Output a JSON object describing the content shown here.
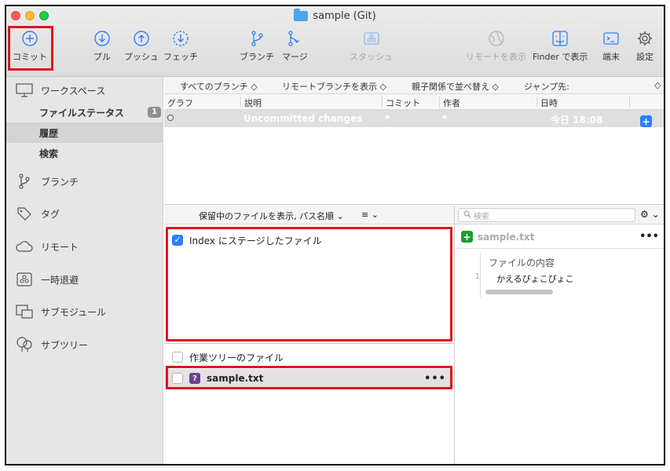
{
  "window": {
    "title": "sample (Git)"
  },
  "toolbar": {
    "commit": "コミット",
    "pull": "プル",
    "push": "プッシュ",
    "fetch": "フェッチ",
    "branch": "ブランチ",
    "merge": "マージ",
    "stash": "スタッシュ",
    "show_remote": "リモートを表示",
    "show_in_finder": "Finder で表示",
    "terminal": "端末",
    "settings": "設定"
  },
  "sidebar": {
    "workspace": "ワークスペース",
    "file_status": "ファイルステータス",
    "file_status_count": "1",
    "history": "履歴",
    "search": "検索",
    "branches": "ブランチ",
    "tags": "タグ",
    "remotes": "リモート",
    "stashes": "一時退避",
    "submodules": "サブモジュール",
    "subtrees": "サブツリー"
  },
  "history_filter": {
    "all_branches": "すべてのブランチ",
    "show_remote_branches": "リモートブランチを表示",
    "sort": "親子関係で並べ替え",
    "jump_to": "ジャンプ先:"
  },
  "history_columns": {
    "graph": "グラフ",
    "description": "説明",
    "commit": "コミット",
    "author": "作者",
    "date": "日時"
  },
  "history_rows": [
    {
      "description": "Uncommitted changes",
      "commit": "*",
      "author": "*",
      "date": "今日 18:08"
    }
  ],
  "staging": {
    "view_mode": "保留中のファイルを表示, パス名順",
    "staged_header": "Index にステージしたファイル",
    "unstaged_header": "作業ツリーのファイル",
    "unstaged_files": [
      "sample.txt"
    ]
  },
  "search": {
    "placeholder": "検索"
  },
  "diff": {
    "filename": "sample.txt",
    "hunk_title": "ファイルの内容",
    "line_number": "1",
    "line_text": "かえるぴょこぴょこ"
  },
  "colors": {
    "accent_blue": "#2d7ff9",
    "highlight_red": "#e0141e",
    "added_green": "#1e9d2e",
    "untracked_purple": "#6b3f8e"
  }
}
